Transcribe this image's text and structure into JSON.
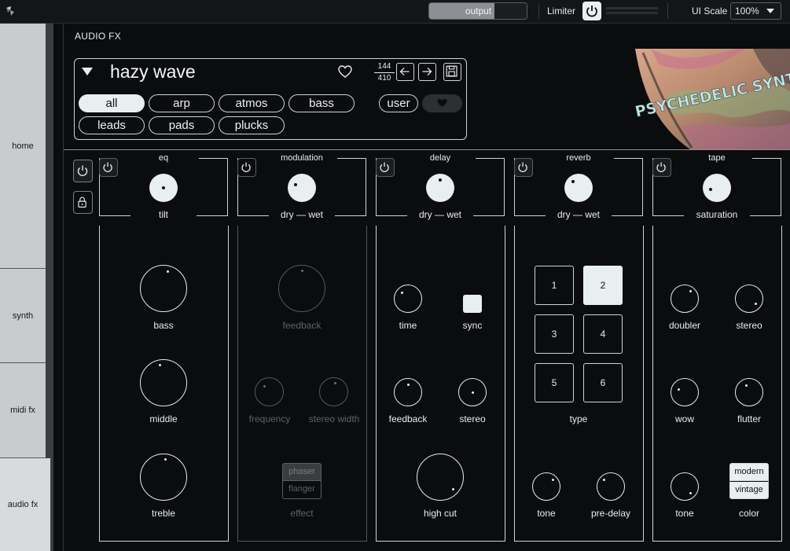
{
  "topbar": {
    "output_label": "output",
    "output_level": 0.67,
    "limiter_label": "Limiter",
    "ui_scale_label": "UI Scale",
    "ui_scale_value": "100%"
  },
  "nav": {
    "items": [
      {
        "label": "home"
      },
      {
        "label": "synth"
      },
      {
        "label": "midi fx"
      },
      {
        "label": "audio fx",
        "active": true
      }
    ]
  },
  "header": {
    "section_title": "AUDIO FX",
    "preset_name": "hazy wave",
    "preset_index": "144",
    "preset_total": "410",
    "tags": [
      {
        "label": "all",
        "active": true
      },
      {
        "label": "arp"
      },
      {
        "label": "atmos"
      },
      {
        "label": "bass"
      },
      {
        "label": "user"
      },
      {
        "label": "leads"
      },
      {
        "label": "pads"
      },
      {
        "label": "plucks"
      }
    ],
    "artwork_text": "PSYCHEDELIC SYNTHS"
  },
  "modules": {
    "eq": {
      "title": "eq",
      "main_label": "tilt",
      "knobs": [
        "bass",
        "middle",
        "treble"
      ]
    },
    "modulation": {
      "title": "modulation",
      "main_label": "dry — wet",
      "feedback": "feedback",
      "frequency": "frequency",
      "stereo_width": "stereo width",
      "effect_options": [
        "phaser",
        "flanger"
      ],
      "effect_label": "effect"
    },
    "delay": {
      "title": "delay",
      "main_label": "dry — wet",
      "time": "time",
      "sync": "sync",
      "feedback": "feedback",
      "stereo": "stereo",
      "high_cut": "high cut"
    },
    "reverb": {
      "title": "reverb",
      "main_label": "dry — wet",
      "types": [
        "1",
        "2",
        "3",
        "4",
        "5",
        "6"
      ],
      "selected_type": "2",
      "type_label": "type",
      "tone": "tone",
      "pre_delay": "pre-delay"
    },
    "tape": {
      "title": "tape",
      "main_label": "saturation",
      "doubler": "doubler",
      "stereo": "stereo",
      "wow": "wow",
      "flutter": "flutter",
      "tone": "tone",
      "color_options": [
        "modern",
        "vintage"
      ],
      "color_label": "color"
    }
  },
  "colors": {
    "background": "#0b0c0e",
    "accent": "#e9eef1",
    "nav": "#c9cbcd",
    "line": "#cfd3d6"
  }
}
